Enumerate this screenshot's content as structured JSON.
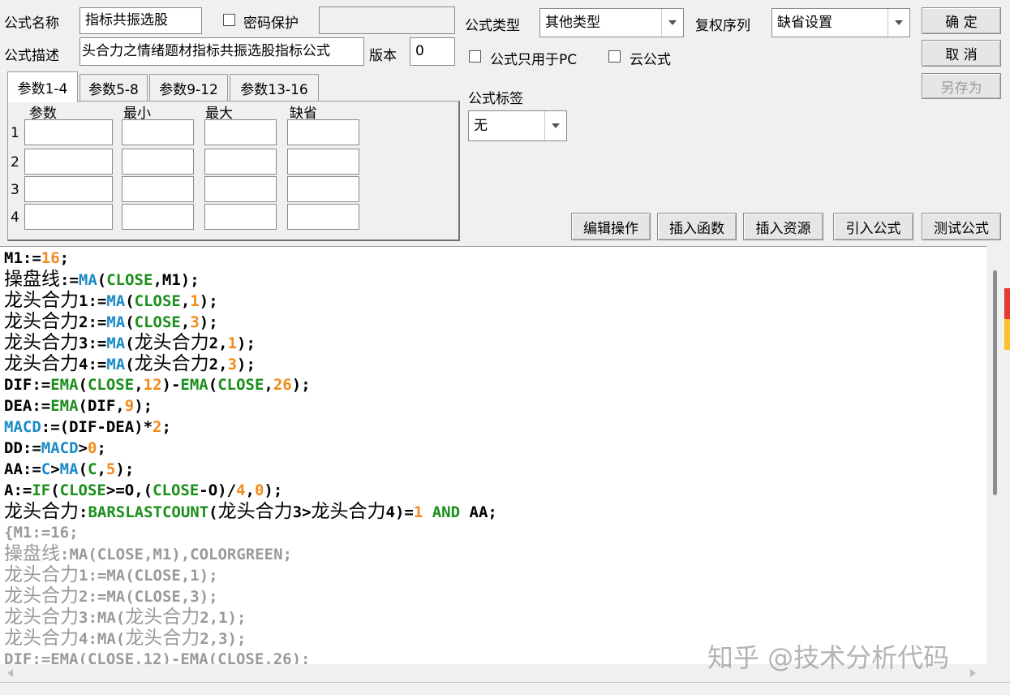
{
  "header": {
    "formula_name_label": "公式名称",
    "formula_name_value": "指标共振选股",
    "password_label": "密码保护",
    "formula_type_label": "公式类型",
    "formula_type_value": "其他类型",
    "rights_label": "复权序列",
    "rights_value": "缺省设置",
    "desc_label": "公式描述",
    "desc_value": "头合力之情绪题材指标共振选股指标公式",
    "version_label": "版本",
    "version_value": "0",
    "pc_only_label": "公式只用于PC",
    "cloud_label": "云公式",
    "tag_label": "公式标签",
    "tag_value": "无"
  },
  "buttons": {
    "ok": "确 定",
    "cancel": "取 消",
    "save_as": "另存为",
    "edit_ops": "编辑操作",
    "insert_func": "插入函数",
    "insert_res": "插入资源",
    "import_formula": "引入公式",
    "test_formula": "测试公式"
  },
  "tabs": [
    {
      "label": "参数1-4",
      "active": true
    },
    {
      "label": "参数5-8",
      "active": false
    },
    {
      "label": "参数9-12",
      "active": false
    },
    {
      "label": "参数13-16",
      "active": false
    }
  ],
  "params": {
    "col_param": "参数",
    "col_min": "最小",
    "col_max": "最大",
    "col_default": "缺省",
    "rows": [
      "1",
      "2",
      "3",
      "4"
    ]
  },
  "code": {
    "l1": [
      "M1",
      ":=",
      "16",
      ";"
    ],
    "l2": [
      "操盘线",
      ":=",
      "MA",
      "(",
      "CLOSE",
      ",M1);"
    ],
    "l3": [
      "龙头合力",
      "1:=",
      "MA",
      "(",
      "CLOSE",
      ",",
      "1",
      ");"
    ],
    "l4": [
      "龙头合力",
      "2:=",
      "MA",
      "(",
      "CLOSE",
      ",",
      "3",
      ");"
    ],
    "l5": [
      "龙头合力",
      "3:=",
      "MA",
      "(",
      "龙头合力",
      "2,",
      "1",
      ");"
    ],
    "l6": [
      "龙头合力",
      "4:=",
      "MA",
      "(",
      "龙头合力",
      "2,",
      "3",
      ");"
    ],
    "l7": [
      "DIF:=",
      "EMA",
      "(",
      "CLOSE",
      ",",
      "12",
      ")-",
      "EMA",
      "(",
      "CLOSE",
      ",",
      "26",
      ");"
    ],
    "l8": [
      "DEA:=",
      "EMA",
      "(DIF,",
      "9",
      ");"
    ],
    "l9": [
      "MACD",
      ":=(DIF-DEA)*",
      "2",
      ";"
    ],
    "l10": [
      "DD:=",
      "MACD",
      ">",
      "0",
      ";"
    ],
    "l11": [
      "AA:=",
      "C",
      ">",
      "MA",
      "(",
      "C",
      ",",
      "5",
      ");"
    ],
    "l12": [
      "A:=",
      "IF",
      "(",
      "CLOSE",
      ">=O,(",
      "CLOSE",
      "-O)/",
      "4",
      ",",
      "0",
      ");"
    ],
    "l13": [
      "龙头合力",
      ":",
      "BARSLASTCOUNT",
      "(",
      "龙头合力",
      "3>",
      "龙头合力",
      "4)=",
      "1",
      " AND ",
      "AA;"
    ],
    "c1": "{M1:=16;",
    "c2": [
      "操盘线",
      ":MA(CLOSE,M1),COLORGREEN;"
    ],
    "c3": [
      "龙头合力",
      "1:=MA(CLOSE,1);"
    ],
    "c4": [
      "龙头合力",
      "2:=MA(CLOSE,3);"
    ],
    "c5": [
      "龙头合力",
      "3:MA(",
      "龙头合力",
      "2,1);"
    ],
    "c6": [
      "龙头合力",
      "4:MA(",
      "龙头合力",
      "2,3);"
    ],
    "c7": "DIF:=EMA(CLOSE,12)-EMA(CLOSE,26);"
  },
  "watermark": "知乎 @技术分析代码",
  "colors": {
    "keyword": "#1a8ac8",
    "function": "#1b8f1b",
    "number": "#f28a1b",
    "comment": "#9a9a9a"
  }
}
